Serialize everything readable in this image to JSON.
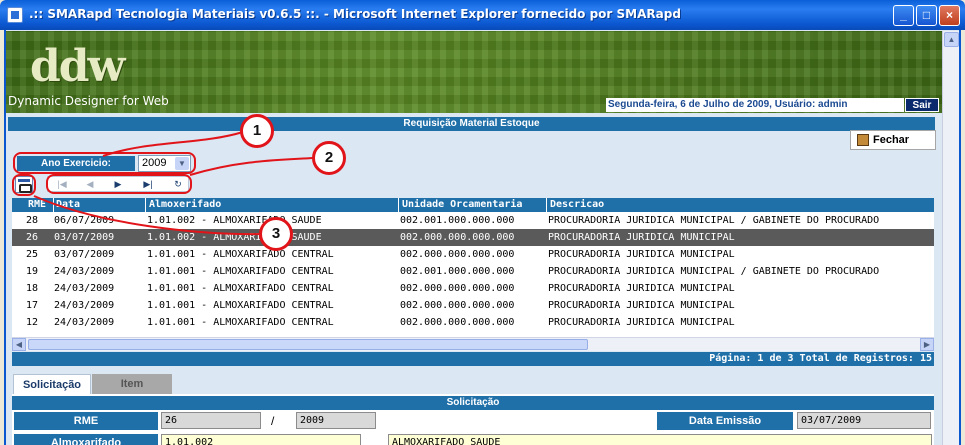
{
  "window": {
    "title": ".:: SMARapd Tecnologia Materiais v0.6.5 ::. - Microsoft Internet Explorer fornecido por SMARapd",
    "minimize": "_",
    "maximize": "□",
    "close": "×"
  },
  "banner": {
    "logo": "ddw",
    "subtitle": "Dynamic Designer for Web",
    "status": "Segunda-feira, 6 de Julho de 2009, Usuário: admin",
    "sair": "Sair"
  },
  "page_title": "Requisição Material Estoque",
  "fechar_label": "Fechar",
  "filter": {
    "ano_label": "Ano Exercicio:",
    "ano_value": "2009"
  },
  "navigation": {
    "first": "|◀",
    "prev": "◀",
    "next": "▶",
    "last": "▶|",
    "refresh": "↻"
  },
  "annotations": [
    "1",
    "2",
    "3"
  ],
  "grid": {
    "columns": [
      "RME",
      "Data",
      "Almoxerifado",
      "Unidade Orcamentaria",
      "Descricao"
    ],
    "rows": [
      {
        "rme": "28",
        "data": "06/07/2009",
        "almox": "1.01.002 - ALMOXARIFADO SAUDE",
        "uo": "002.001.000.000.000",
        "desc": "PROCURADORIA JURIDICA MUNICIPAL / GABINETE DO PROCURADO"
      },
      {
        "rme": "26",
        "data": "03/07/2009",
        "almox": "1.01.002 - ALMOXARIFADO SAUDE",
        "uo": "002.000.000.000.000",
        "desc": "PROCURADORIA JURIDICA MUNICIPAL"
      },
      {
        "rme": "25",
        "data": "03/07/2009",
        "almox": "1.01.001 - ALMOXARIFADO CENTRAL",
        "uo": "002.000.000.000.000",
        "desc": "PROCURADORIA JURIDICA MUNICIPAL"
      },
      {
        "rme": "19",
        "data": "24/03/2009",
        "almox": "1.01.001 - ALMOXARIFADO CENTRAL",
        "uo": "002.001.000.000.000",
        "desc": "PROCURADORIA JURIDICA MUNICIPAL / GABINETE DO PROCURADO"
      },
      {
        "rme": "18",
        "data": "24/03/2009",
        "almox": "1.01.001 - ALMOXARIFADO CENTRAL",
        "uo": "002.000.000.000.000",
        "desc": "PROCURADORIA JURIDICA MUNICIPAL"
      },
      {
        "rme": "17",
        "data": "24/03/2009",
        "almox": "1.01.001 - ALMOXARIFADO CENTRAL",
        "uo": "002.000.000.000.000",
        "desc": "PROCURADORIA JURIDICA MUNICIPAL"
      },
      {
        "rme": "12",
        "data": "24/03/2009",
        "almox": "1.01.001 - ALMOXARIFADO CENTRAL",
        "uo": "002.000.000.000.000",
        "desc": "PROCURADORIA JURIDICA MUNICIPAL"
      }
    ],
    "selected_index": 1
  },
  "pagination": "Página: 1 de 3 Total de Registros: 15",
  "tabs": {
    "solicitacao": "Solicitação",
    "item": "Item"
  },
  "form": {
    "section_title": "Solicitação",
    "rme_label": "RME",
    "rme_value": "26",
    "separator": "/",
    "year_value": "2009",
    "data_emissao_label": "Data Emissão",
    "data_emissao_value": "03/07/2009",
    "almoxarifado_label": "Almoxarifado",
    "almoxarifado_code": "1.01.002",
    "almoxarifado_name": "ALMOXARIFADO SAUDE"
  },
  "colors": {
    "header_blue": "#1f6fa8",
    "selected_row": "#5a5a5a",
    "annotation_red": "#e1141a"
  }
}
